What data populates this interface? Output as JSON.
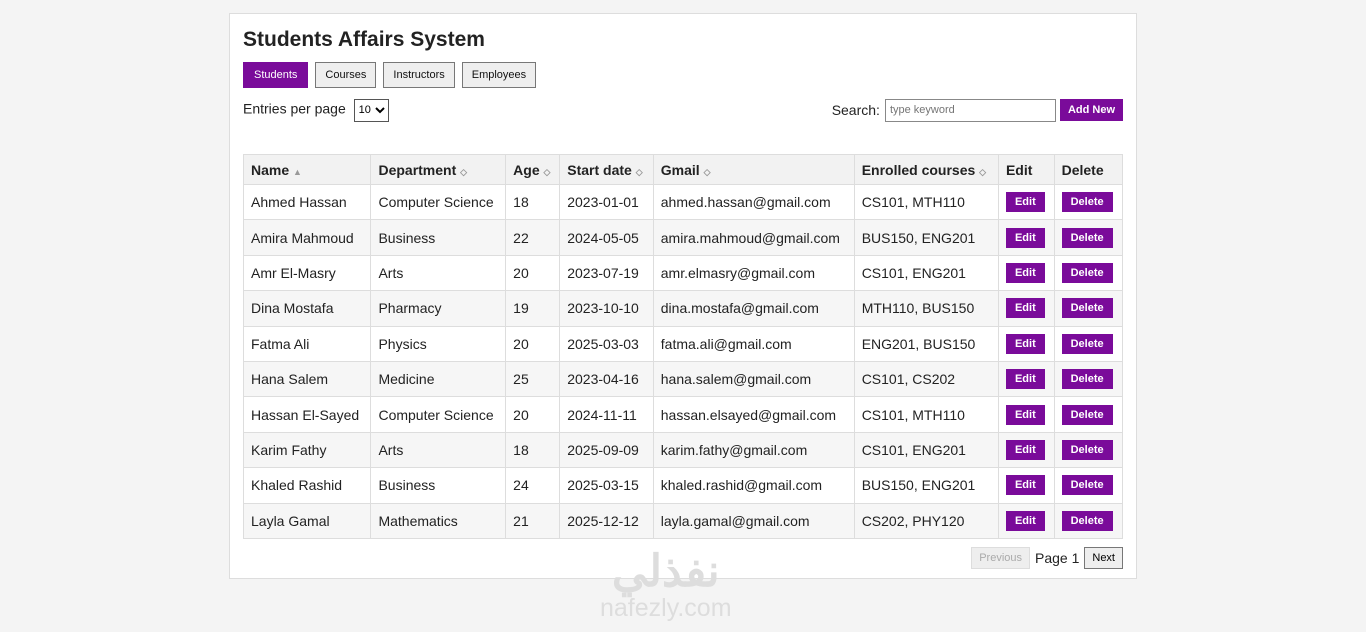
{
  "title": "Students Affairs System",
  "tabs": [
    "Students",
    "Courses",
    "Instructors",
    "Employees"
  ],
  "entries_label": "Entries per page",
  "entries_value": "10",
  "search_label": "Search:",
  "search_placeholder": "type keyword",
  "add_new": "Add New",
  "columns": [
    "Name",
    "Department",
    "Age",
    "Start date",
    "Gmail",
    "Enrolled courses",
    "Edit",
    "Delete"
  ],
  "sort_icons": [
    "▲",
    "◇",
    "◇",
    "◇",
    "◇",
    "◇",
    "",
    ""
  ],
  "rows": [
    [
      "Ahmed Hassan",
      "Computer Science",
      "18",
      "2023-01-01",
      "ahmed.hassan@gmail.com",
      "CS101, MTH110"
    ],
    [
      "Amira Mahmoud",
      "Business",
      "22",
      "2024-05-05",
      "amira.mahmoud@gmail.com",
      "BUS150, ENG201"
    ],
    [
      "Amr El-Masry",
      "Arts",
      "20",
      "2023-07-19",
      "amr.elmasry@gmail.com",
      "CS101, ENG201"
    ],
    [
      "Dina Mostafa",
      "Pharmacy",
      "19",
      "2023-10-10",
      "dina.mostafa@gmail.com",
      "MTH110, BUS150"
    ],
    [
      "Fatma Ali",
      "Physics",
      "20",
      "2025-03-03",
      "fatma.ali@gmail.com",
      "ENG201, BUS150"
    ],
    [
      "Hana Salem",
      "Medicine",
      "25",
      "2023-04-16",
      "hana.salem@gmail.com",
      "CS101, CS202"
    ],
    [
      "Hassan El-Sayed",
      "Computer Science",
      "20",
      "2024-11-11",
      "hassan.elsayed@gmail.com",
      "CS101, MTH110"
    ],
    [
      "Karim Fathy",
      "Arts",
      "18",
      "2025-09-09",
      "karim.fathy@gmail.com",
      "CS101, ENG201"
    ],
    [
      "Khaled Rashid",
      "Business",
      "24",
      "2025-03-15",
      "khaled.rashid@gmail.com",
      "BUS150, ENG201"
    ],
    [
      "Layla Gamal",
      "Mathematics",
      "21",
      "2025-12-12",
      "layla.gamal@gmail.com",
      "CS202, PHY120"
    ]
  ],
  "edit_label": "Edit",
  "delete_label": "Delete",
  "pager": {
    "previous": "Previous",
    "page": "Page 1",
    "next": "Next"
  },
  "watermark": {
    "arabic": "نفذلي",
    "latin": "nafezly.com"
  },
  "accent": "#7a0b9a"
}
